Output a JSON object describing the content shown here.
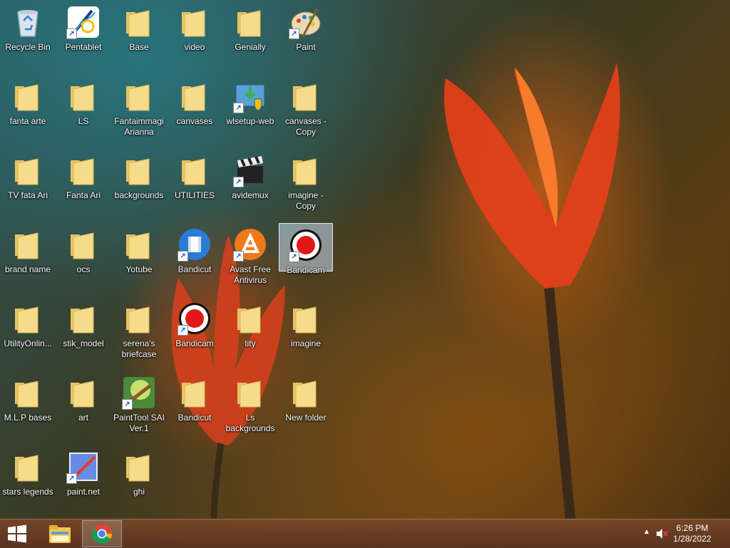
{
  "desktop_icons": [
    {
      "label": "Recycle Bin",
      "icon": "recycle-bin-icon",
      "type": "recycle"
    },
    {
      "label": "Pentablet",
      "icon": "pentablet-icon",
      "type": "app-pen"
    },
    {
      "label": "Base",
      "icon": "folder-icon",
      "type": "folder"
    },
    {
      "label": "video",
      "icon": "folder-icon",
      "type": "folder"
    },
    {
      "label": "Genially",
      "icon": "folder-icon",
      "type": "folder"
    },
    {
      "label": "Paint",
      "icon": "paint-palette-icon",
      "type": "app-paint"
    },
    {
      "label": "fanta arte",
      "icon": "folder-icon",
      "type": "folder"
    },
    {
      "label": "LS",
      "icon": "folder-icon",
      "type": "folder"
    },
    {
      "label": "Fantaimmagi Arianna",
      "icon": "folder-icon",
      "type": "folder"
    },
    {
      "label": "canvases",
      "icon": "folder-icon",
      "type": "folder"
    },
    {
      "label": "wlsetup-web",
      "icon": "installer-icon",
      "type": "app-setup"
    },
    {
      "label": "canvases - Copy",
      "icon": "folder-icon",
      "type": "folder"
    },
    {
      "label": "TV fata Ari",
      "icon": "folder-icon",
      "type": "folder"
    },
    {
      "label": "Fanta Ari",
      "icon": "folder-icon",
      "type": "folder"
    },
    {
      "label": "backgrounds",
      "icon": "folder-icon",
      "type": "folder"
    },
    {
      "label": "UTILITIES",
      "icon": "folder-icon",
      "type": "folder"
    },
    {
      "label": "avidemux",
      "icon": "clapperboard-icon",
      "type": "app-clap"
    },
    {
      "label": "imagine - Copy",
      "icon": "folder-icon",
      "type": "folder"
    },
    {
      "label": "brand name",
      "icon": "folder-icon",
      "type": "folder"
    },
    {
      "label": "ocs",
      "icon": "folder-icon",
      "type": "folder"
    },
    {
      "label": "Yotube",
      "icon": "folder-icon",
      "type": "folder"
    },
    {
      "label": "Bandicut",
      "icon": "bandicut-icon",
      "type": "app-bandicut"
    },
    {
      "label": "Avast Free Antivirus",
      "icon": "avast-icon",
      "type": "app-avast"
    },
    {
      "label": "Bandicam",
      "icon": "bandicam-icon",
      "type": "app-bandicam",
      "selected": true
    },
    {
      "label": "UtilityOnlin...",
      "icon": "folder-icon",
      "type": "folder"
    },
    {
      "label": "stik_model",
      "icon": "folder-icon",
      "type": "folder"
    },
    {
      "label": "serena's briefcase",
      "icon": "folder-icon",
      "type": "folder"
    },
    {
      "label": "Bandicam",
      "icon": "bandicam-icon",
      "type": "app-bandicam"
    },
    {
      "label": "tity",
      "icon": "folder-icon",
      "type": "folder"
    },
    {
      "label": "imagine",
      "icon": "folder-icon",
      "type": "folder"
    },
    {
      "label": "M.L.P bases",
      "icon": "folder-icon",
      "type": "folder"
    },
    {
      "label": "art",
      "icon": "folder-icon",
      "type": "folder"
    },
    {
      "label": "PaintTool SAI Ver.1",
      "icon": "painttool-sai-icon",
      "type": "app-sai"
    },
    {
      "label": "Bandicut",
      "icon": "folder-icon",
      "type": "folder"
    },
    {
      "label": "Ls backgrounds",
      "icon": "folder-icon",
      "type": "folder"
    },
    {
      "label": "New folder",
      "icon": "folder-icon",
      "type": "folder"
    },
    {
      "label": "stars legends",
      "icon": "folder-icon",
      "type": "folder"
    },
    {
      "label": "paint.net",
      "icon": "paintnet-icon",
      "type": "app-paintnet"
    },
    {
      "label": "ghi",
      "icon": "folder-icon",
      "type": "folder"
    }
  ],
  "taskbar": {
    "start_icon": "windows-logo-icon",
    "pinned": [
      {
        "name": "file-explorer",
        "icon": "file-explorer-icon"
      },
      {
        "name": "chrome",
        "icon": "chrome-icon",
        "active": true
      }
    ],
    "tray": {
      "time": "6:26 PM",
      "date": "1/28/2022",
      "volume_icon": "volume-muted-icon",
      "overflow_icon": "chevron-up-icon"
    }
  },
  "colors": {
    "folder": "#f3d57a",
    "taskbar": "#6e4128",
    "accent_red": "#e23c1e"
  }
}
